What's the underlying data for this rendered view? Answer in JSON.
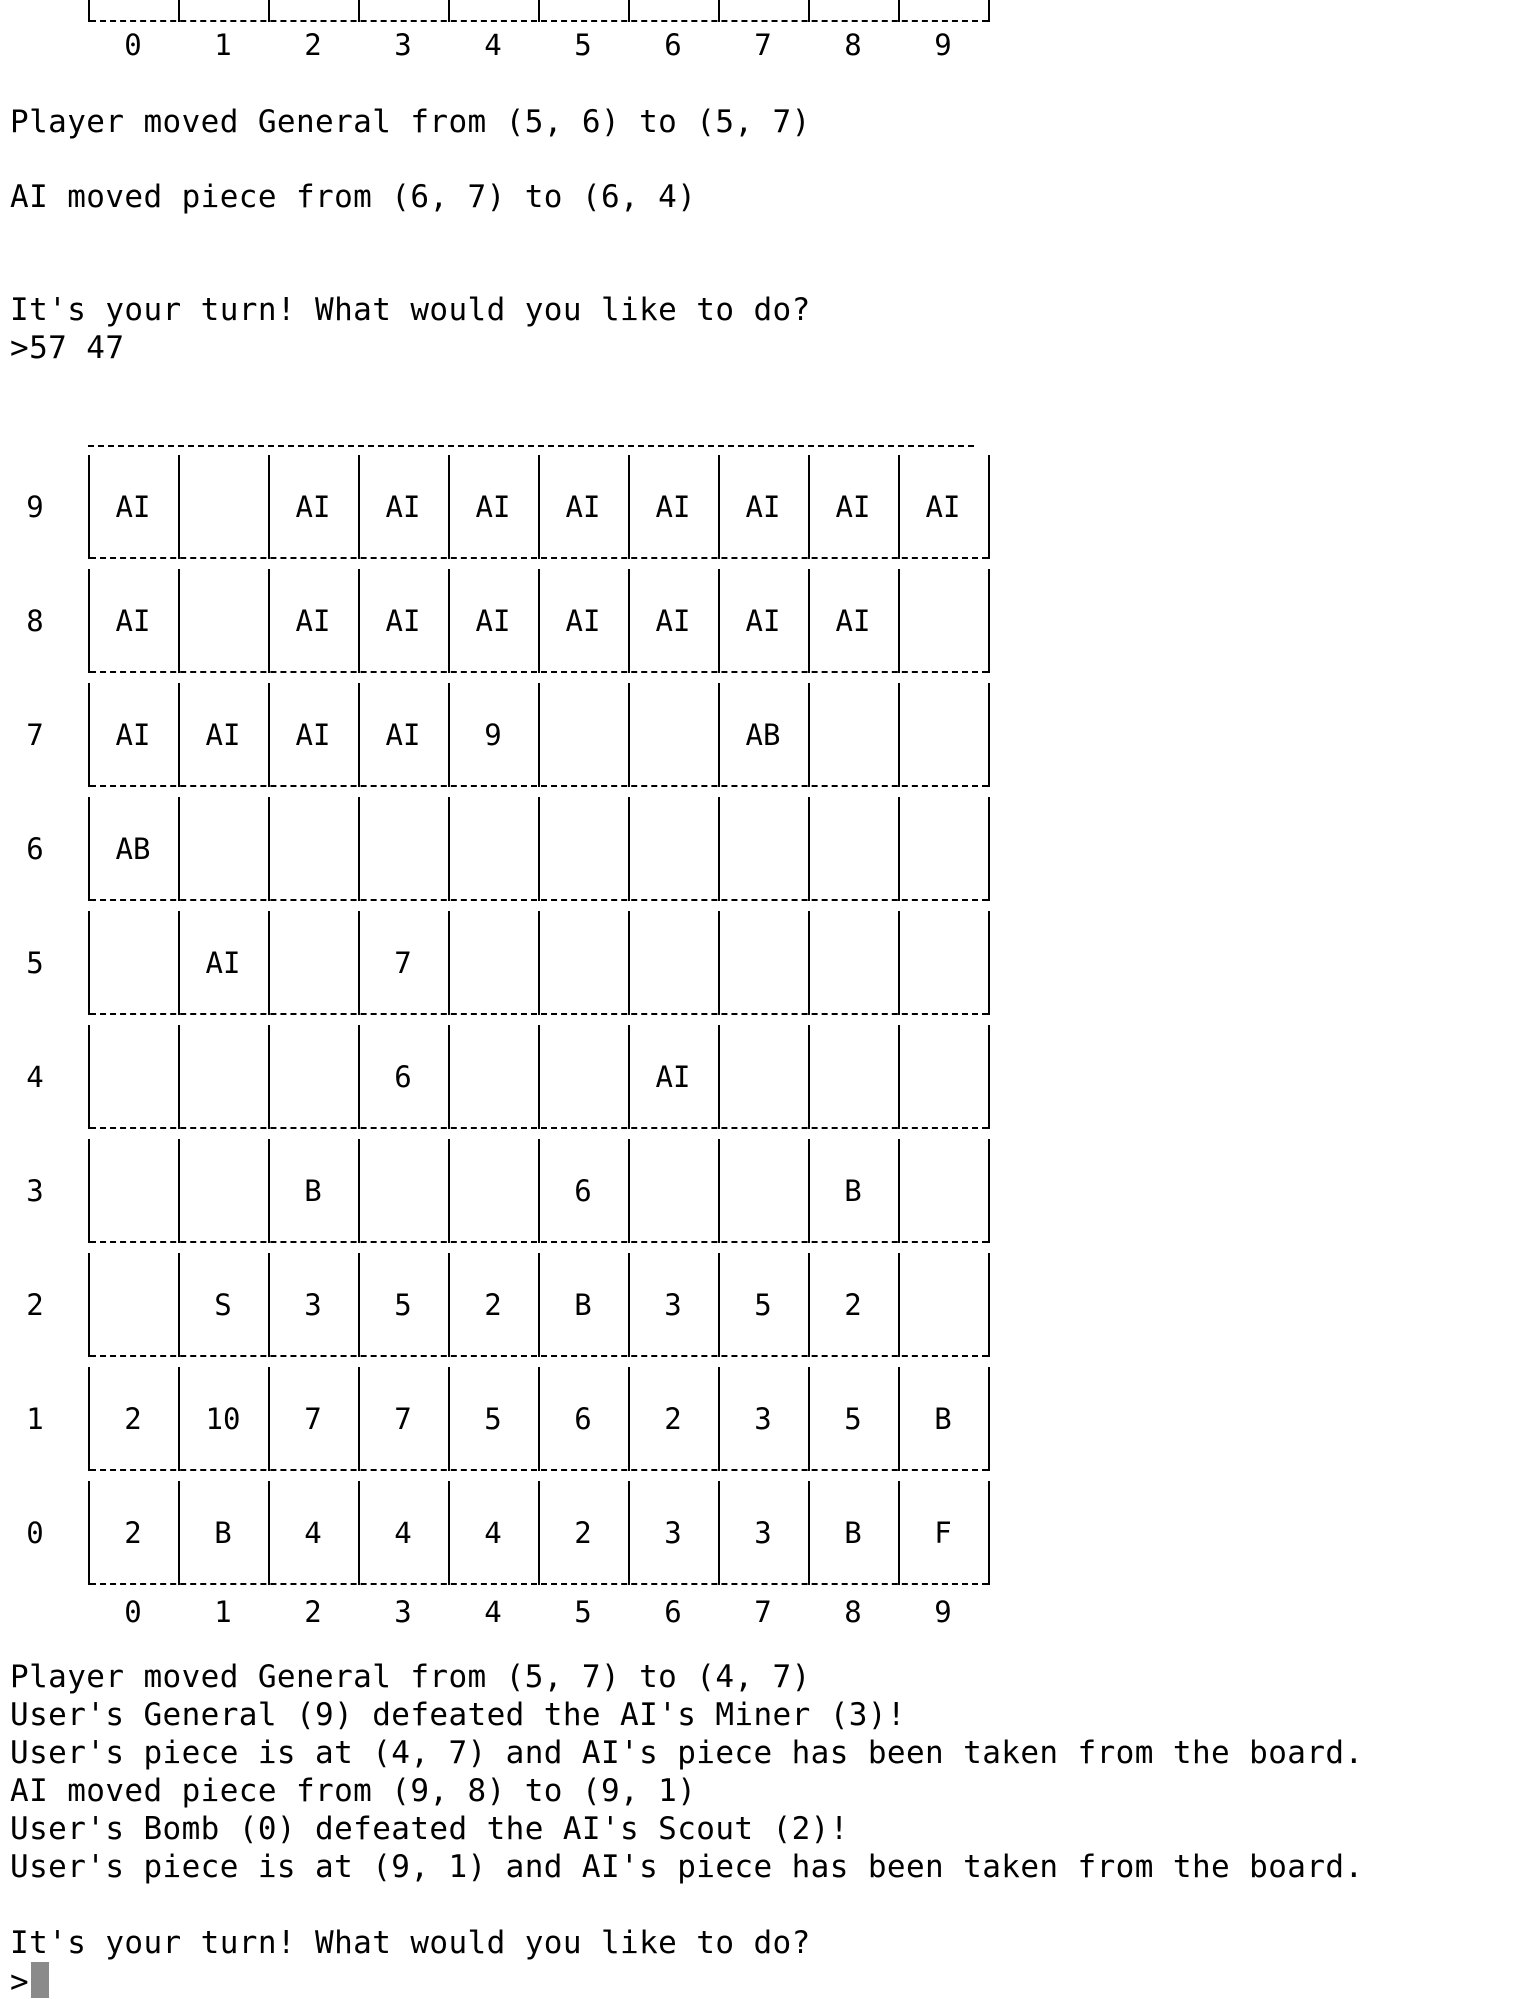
{
  "top_col_labels": [
    "0",
    "1",
    "2",
    "3",
    "4",
    "5",
    "6",
    "7",
    "8",
    "9"
  ],
  "log_top": [
    "Player moved General from (5, 6) to (5, 7)",
    "AI moved piece from (6, 7) to (6, 4)"
  ],
  "prompt1": {
    "question": "It's your turn! What would you like to do?",
    "input": ">57 47"
  },
  "board": {
    "rows": [
      {
        "label": "9",
        "cells": [
          "AI",
          "",
          "AI",
          "AI",
          "AI",
          "AI",
          "AI",
          "AI",
          "AI",
          "AI"
        ]
      },
      {
        "label": "8",
        "cells": [
          "AI",
          "",
          "AI",
          "AI",
          "AI",
          "AI",
          "AI",
          "AI",
          "AI",
          ""
        ]
      },
      {
        "label": "7",
        "cells": [
          "AI",
          "AI",
          "AI",
          "AI",
          "9",
          "",
          "",
          "AB",
          "",
          ""
        ]
      },
      {
        "label": "6",
        "cells": [
          "AB",
          "",
          "",
          "",
          "",
          "",
          "",
          "",
          "",
          ""
        ]
      },
      {
        "label": "5",
        "cells": [
          "",
          "AI",
          "",
          "7",
          "",
          "",
          "",
          "",
          "",
          ""
        ]
      },
      {
        "label": "4",
        "cells": [
          "",
          "",
          "",
          "6",
          "",
          "",
          "AI",
          "",
          "",
          ""
        ]
      },
      {
        "label": "3",
        "cells": [
          "",
          "",
          "B",
          "",
          "",
          "6",
          "",
          "",
          "B",
          ""
        ]
      },
      {
        "label": "2",
        "cells": [
          "",
          "S",
          "3",
          "5",
          "2",
          "B",
          "3",
          "5",
          "2",
          ""
        ]
      },
      {
        "label": "1",
        "cells": [
          "2",
          "10",
          "7",
          "7",
          "5",
          "6",
          "2",
          "3",
          "5",
          "B"
        ]
      },
      {
        "label": "0",
        "cells": [
          "2",
          "B",
          "4",
          "4",
          "4",
          "2",
          "3",
          "3",
          "B",
          "F"
        ]
      }
    ],
    "col_labels": [
      "0",
      "1",
      "2",
      "3",
      "4",
      "5",
      "6",
      "7",
      "8",
      "9"
    ]
  },
  "log_bottom": [
    "Player moved General from (5, 7) to (4, 7)",
    "User's General (9) defeated the AI's Miner (3)!",
    "User's piece is at (4, 7) and AI's piece has been taken from the board.",
    "AI moved piece from (9, 8) to (9, 1)",
    "User's Bomb (0) defeated the AI's Scout (2)!",
    "User's piece is at (9, 1) and AI's piece has been taken from the board."
  ],
  "prompt2": {
    "question": "It's your turn! What would you like to do?",
    "input": ">"
  }
}
